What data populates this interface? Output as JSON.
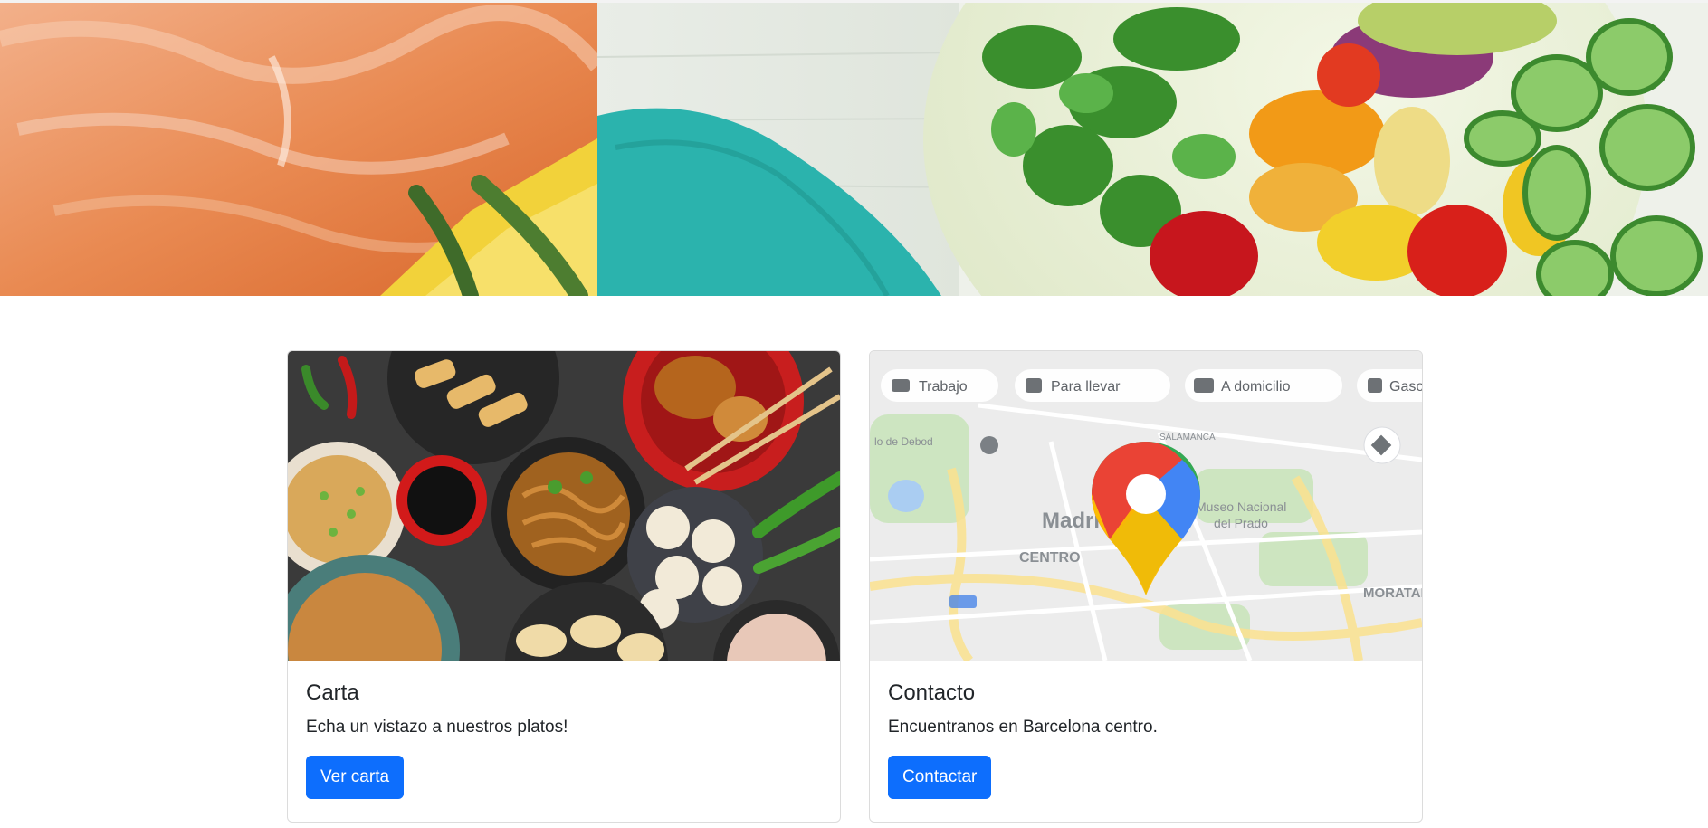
{
  "hero": {
    "image": "fresh-food-banner"
  },
  "cards": [
    {
      "image": "asian-dishes-photo",
      "title": "Carta",
      "text": "Echa un vistazo a nuestros platos!",
      "button_label": "Ver carta"
    },
    {
      "image": "google-maps-preview",
      "title": "Contacto",
      "text": "Encuentranos en Barcelona centro.",
      "button_label": "Contactar",
      "map": {
        "chips": [
          "Trabajo",
          "Para llevar",
          "A domicilio",
          "Gaso"
        ],
        "labels": {
          "madrid": "Madrid",
          "centro": "CENTRO",
          "moratalaz": "MORATAL",
          "debod": "lo de Debod",
          "museo": "Museo Nacional",
          "prado": "del Prado",
          "salamanca": "SALAMANCA"
        }
      }
    }
  ],
  "colors": {
    "primary_button": "#0d6efd",
    "card_border": "#dcdcdc"
  }
}
